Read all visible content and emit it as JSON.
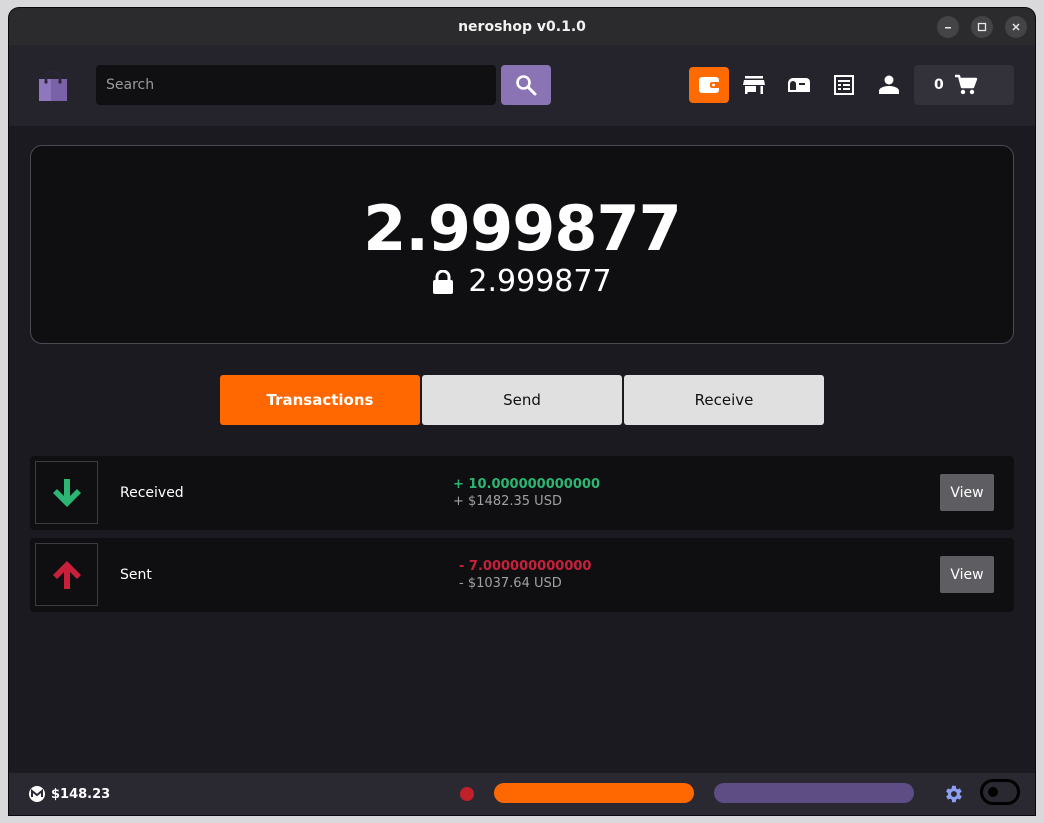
{
  "window": {
    "title": "neroshop v0.1.0"
  },
  "header": {
    "search": {
      "placeholder": "Search",
      "value": ""
    },
    "nav": [
      {
        "name": "wallet-icon",
        "active": true
      },
      {
        "name": "store-icon",
        "active": false
      },
      {
        "name": "mailbox-icon",
        "active": false
      },
      {
        "name": "orders-icon",
        "active": false
      },
      {
        "name": "account-icon",
        "active": false
      }
    ],
    "cart": {
      "count": "0"
    }
  },
  "balance": {
    "unlocked": "2.999877",
    "locked": "2.999877"
  },
  "tabs": [
    {
      "label": "Transactions",
      "active": true
    },
    {
      "label": "Send",
      "active": false
    },
    {
      "label": "Receive",
      "active": false
    }
  ],
  "transactions": [
    {
      "direction": "received",
      "label": "Received",
      "amount": "+ 10.000000000000",
      "usd": "+ $1482.35 USD",
      "view": "View",
      "color": "#2bb673"
    },
    {
      "direction": "sent",
      "label": "Sent",
      "amount": "- 7.000000000000",
      "usd": "- $1037.64 USD",
      "view": "View",
      "color": "#c8203a"
    }
  ],
  "status": {
    "price": "$148.23",
    "connection_color": "#c0202a",
    "progress_bars": [
      {
        "color": "#ff6700",
        "fraction": 1.0
      },
      {
        "color": "#5e4d85",
        "fraction": 1.0
      }
    ]
  },
  "colors": {
    "accent": "#ff6700",
    "brand": "#8b74b3"
  }
}
